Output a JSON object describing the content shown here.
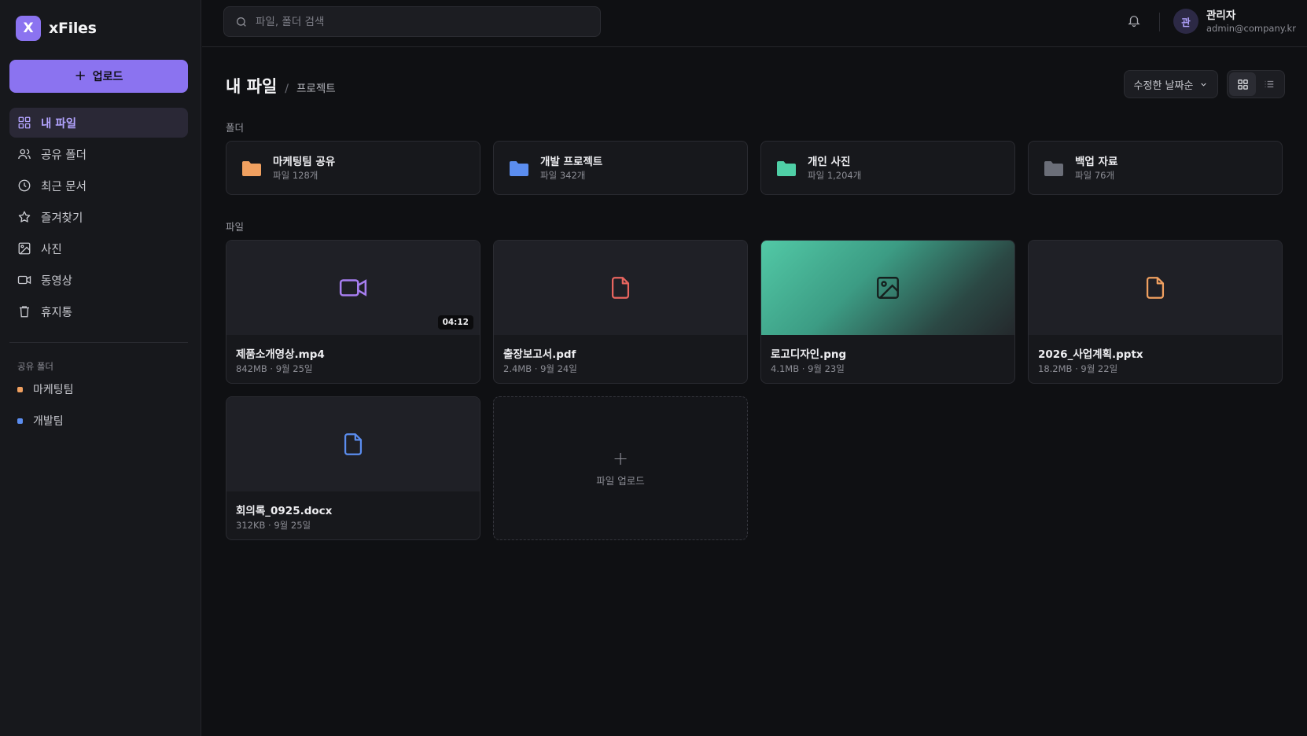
{
  "brand": {
    "logo_letter": "X",
    "name": "xFiles",
    "accent": "#8b73f0"
  },
  "sidebar": {
    "upload_label": "업로드",
    "nav": [
      {
        "label": "내 파일",
        "icon": "grid-icon",
        "active": true
      },
      {
        "label": "공유 폴더",
        "icon": "users-icon"
      },
      {
        "label": "최근 문서",
        "icon": "clock-icon"
      },
      {
        "label": "즐겨찾기",
        "icon": "star-icon"
      },
      {
        "label": "사진",
        "icon": "image-icon"
      },
      {
        "label": "동영상",
        "icon": "video-icon"
      },
      {
        "label": "휴지통",
        "icon": "trash-icon"
      }
    ],
    "shared_section_label": "공유 폴더",
    "shared": [
      {
        "label": "마케팅팀",
        "color": "#f0a060"
      },
      {
        "label": "개발팀",
        "color": "#5b8def"
      }
    ]
  },
  "topbar": {
    "search_placeholder": "파일, 폴더 검색",
    "user": {
      "initial": "관",
      "name": "관리자",
      "email": "admin@company.kr"
    }
  },
  "main": {
    "breadcrumb": {
      "root": "내 파일",
      "separator": "/",
      "current": "프로젝트"
    },
    "sort_label": "수정한 날짜순",
    "view_mode": "grid",
    "folders_label": "폴더",
    "folders": [
      {
        "name": "마케팅팀 공유",
        "meta": "파일 128개",
        "color": "#f0a060"
      },
      {
        "name": "개발 프로젝트",
        "meta": "파일 342개",
        "color": "#5b8def"
      },
      {
        "name": "개인 사진",
        "meta": "파일 1,204개",
        "color": "#4fcfa6"
      },
      {
        "name": "백업 자료",
        "meta": "파일 76개",
        "color": "#6b6e78"
      }
    ],
    "files_label": "파일",
    "files": [
      {
        "name": "제품소개영상.mp4",
        "meta": "842MB · 9월 25일",
        "type": "video",
        "icon": "video-icon",
        "color": "#a77ef0",
        "duration": "04:12"
      },
      {
        "name": "출장보고서.pdf",
        "meta": "2.4MB · 9월 24일",
        "type": "pdf",
        "icon": "file-icon",
        "color": "#e8655f"
      },
      {
        "name": "로고디자인.png",
        "meta": "4.1MB · 9월 23일",
        "type": "image",
        "icon": "image-icon",
        "color": "#15201e"
      },
      {
        "name": "2026_사업계획.pptx",
        "meta": "18.2MB · 9월 22일",
        "type": "pptx",
        "icon": "file-icon",
        "color": "#f0a060"
      },
      {
        "name": "회의록_0925.docx",
        "meta": "312KB · 9월 25일",
        "type": "docx",
        "icon": "file-icon",
        "color": "#5b8def"
      }
    ],
    "upload_card_label": "파일 업로드"
  }
}
